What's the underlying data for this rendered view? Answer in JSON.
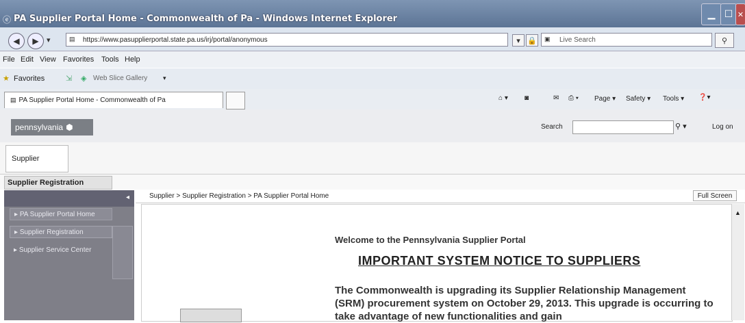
{
  "window": {
    "title": "PA Supplier Portal Home - Commonwealth of Pa - Windows Internet Explorer"
  },
  "address_bar": {
    "url": "https://www.pasupplierportal.state.pa.us/irj/portal/anonymous",
    "search_placeholder": "Live Search"
  },
  "menu": [
    "File",
    "Edit",
    "View",
    "Favorites",
    "Tools",
    "Help"
  ],
  "favorites_bar": {
    "favorites_label": "Favorites",
    "web_slice_label": "Web Slice Gallery"
  },
  "tab": {
    "title": "PA Supplier Portal Home - Commonwealth of Pa"
  },
  "command_bar": {
    "page_label": "Page",
    "safety_label": "Safety",
    "tools_label": "Tools"
  },
  "portal": {
    "logo_text": "pennsylvania",
    "search_label": "Search",
    "logon_label": "Log on",
    "top_tab": "Supplier",
    "sub_tab": "Supplier Registration"
  },
  "left_nav": {
    "items": [
      "PA Supplier Portal Home",
      "Supplier Registration",
      "Supplier Service Center"
    ]
  },
  "breadcrumb": "Supplier  >  Supplier Registration  >  PA Supplier Portal Home",
  "full_screen_label": "Full Screen",
  "content": {
    "welcome": "Welcome to the Pennsylvania Supplier Portal",
    "notice_title": "IMPORTANT SYSTEM NOTICE TO SUPPLIERS",
    "paragraph": "The Commonwealth is upgrading its Supplier Relationship Management (SRM) procurement system on October 29, 2013. This upgrade is occurring to take advantage of new functionalities and gain"
  }
}
